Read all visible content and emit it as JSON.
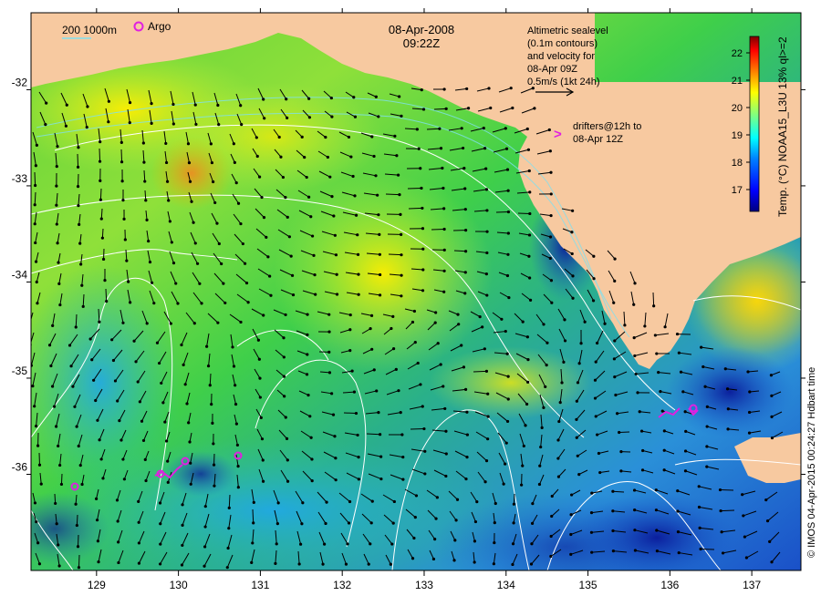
{
  "map": {
    "date": "08-Apr-2008",
    "time": "09:22Z",
    "legend_depth": "200 1000m",
    "legend_argo": "Argo",
    "altimetry_note": [
      "Altimetric sealevel",
      "(0.1m contours)",
      "and velocity for",
      "08-Apr 09Z",
      "0.5m/s (1kt 24h)"
    ],
    "drifter_note": [
      "drifters@12h to",
      "08-Apr 12Z"
    ],
    "drifter_marker": ">",
    "credit": "© IMOS 04-Apr-2015 00:24:27 Hdbart time",
    "colorbar_label": "Temp. (°C) NOAA15_L3U 13% ql>=2",
    "colorbar_ticks": [
      "17",
      "18",
      "19",
      "20",
      "21",
      "22"
    ],
    "colorbar_range": [
      16.2,
      22.6
    ],
    "x_ticks": [
      "129",
      "130",
      "131",
      "132",
      "133",
      "134",
      "135",
      "136",
      "137"
    ],
    "y_ticks": [
      "-32",
      "-33",
      "-34",
      "-35",
      "-36"
    ],
    "lon_range": [
      128.2,
      137.6
    ],
    "lat_range": [
      -37.0,
      -31.2
    ],
    "colors": {
      "land": "#f7c9a0",
      "contour": "#ffffff",
      "argo": "#e020e0",
      "arrows": "#000000",
      "colormap": [
        "#00007f",
        "#0000ff",
        "#0080ff",
        "#00ffff",
        "#80ff80",
        "#ffff00",
        "#ff8000",
        "#ff0000",
        "#7f0000"
      ]
    }
  }
}
